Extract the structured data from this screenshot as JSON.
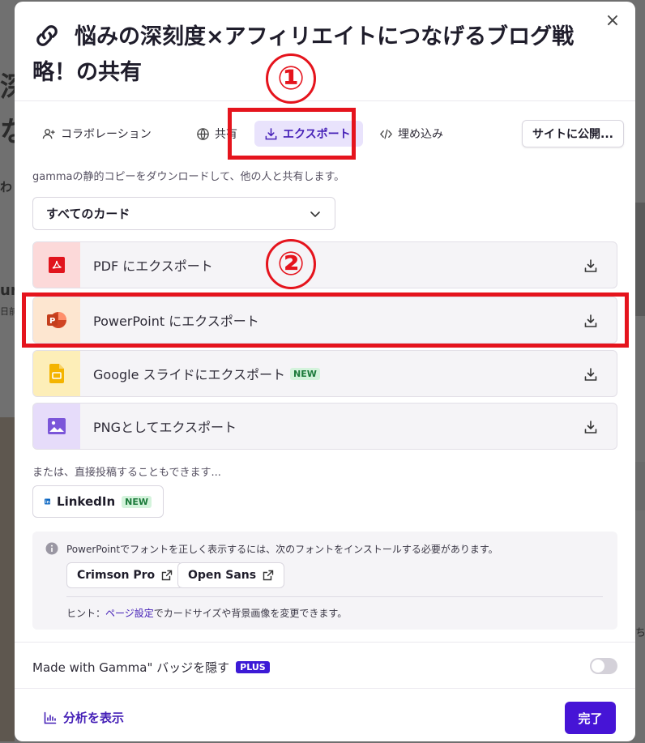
{
  "background": {
    "fragments": [
      "深",
      "な",
      "わ",
      "ur",
      "日前",
      "ち"
    ]
  },
  "modal": {
    "title": "悩みの深刻度×アフィリエイトにつなげるブログ戦略！の共有",
    "title_line1": "悩みの深刻度×アフィリエイトにつなげるブログ戦",
    "title_line2": "略！の共有",
    "close_label": "×"
  },
  "tabs": [
    {
      "label": "コラボレーション",
      "icon": "add-user-icon",
      "active": false
    },
    {
      "label": "共有",
      "icon": "globe-icon",
      "active": false
    },
    {
      "label": "エクスポート",
      "icon": "download-icon",
      "active": true
    },
    {
      "label": "埋め込み",
      "icon": "code-icon",
      "active": false
    }
  ],
  "publish_button": "サイトに公開...",
  "description": "gammaの静的コピーをダウンロードして、他の人と共有します。",
  "card_select": {
    "value": "すべてのカード"
  },
  "export_options": [
    {
      "label": "PDF にエクスポート",
      "icon": "pdf-icon",
      "accent": "#fcd9d9",
      "new": ""
    },
    {
      "label": "PowerPoint にエクスポート",
      "icon": "powerpoint-icon",
      "accent": "#fde6d0",
      "new": ""
    },
    {
      "label": "Google スライドにエクスポート",
      "icon": "google-slides-icon",
      "accent": "#fdeeb8",
      "new": "NEW"
    },
    {
      "label": "PNGとしてエクスポート",
      "icon": "image-icon",
      "accent": "#e6dcfa",
      "new": ""
    }
  ],
  "or_text": "または、直接投稿することもできます...",
  "linkedin": {
    "label": "LinkedIn",
    "badge": "NEW"
  },
  "info": {
    "message": "PowerPointでフォントを正しく表示するには、次のフォントをインストールする必要があります。",
    "fonts": [
      "Crimson Pro",
      "Open Sans"
    ],
    "hint_prefix": "ヒント：",
    "hint_link": "ページ設定",
    "hint_suffix": "でカードサイズや背景画像を変更できます。"
  },
  "badge_setting": {
    "label": "Made with Gamma\" バッジを隠す",
    "plan": "PLUS",
    "enabled": false
  },
  "footer": {
    "analytics": "分析を表示",
    "done": "完了"
  },
  "annotations": [
    "①",
    "②"
  ],
  "colors": {
    "accent": "#4520b7",
    "primary_button": "#4614d6",
    "annotation": "#e5141d"
  }
}
